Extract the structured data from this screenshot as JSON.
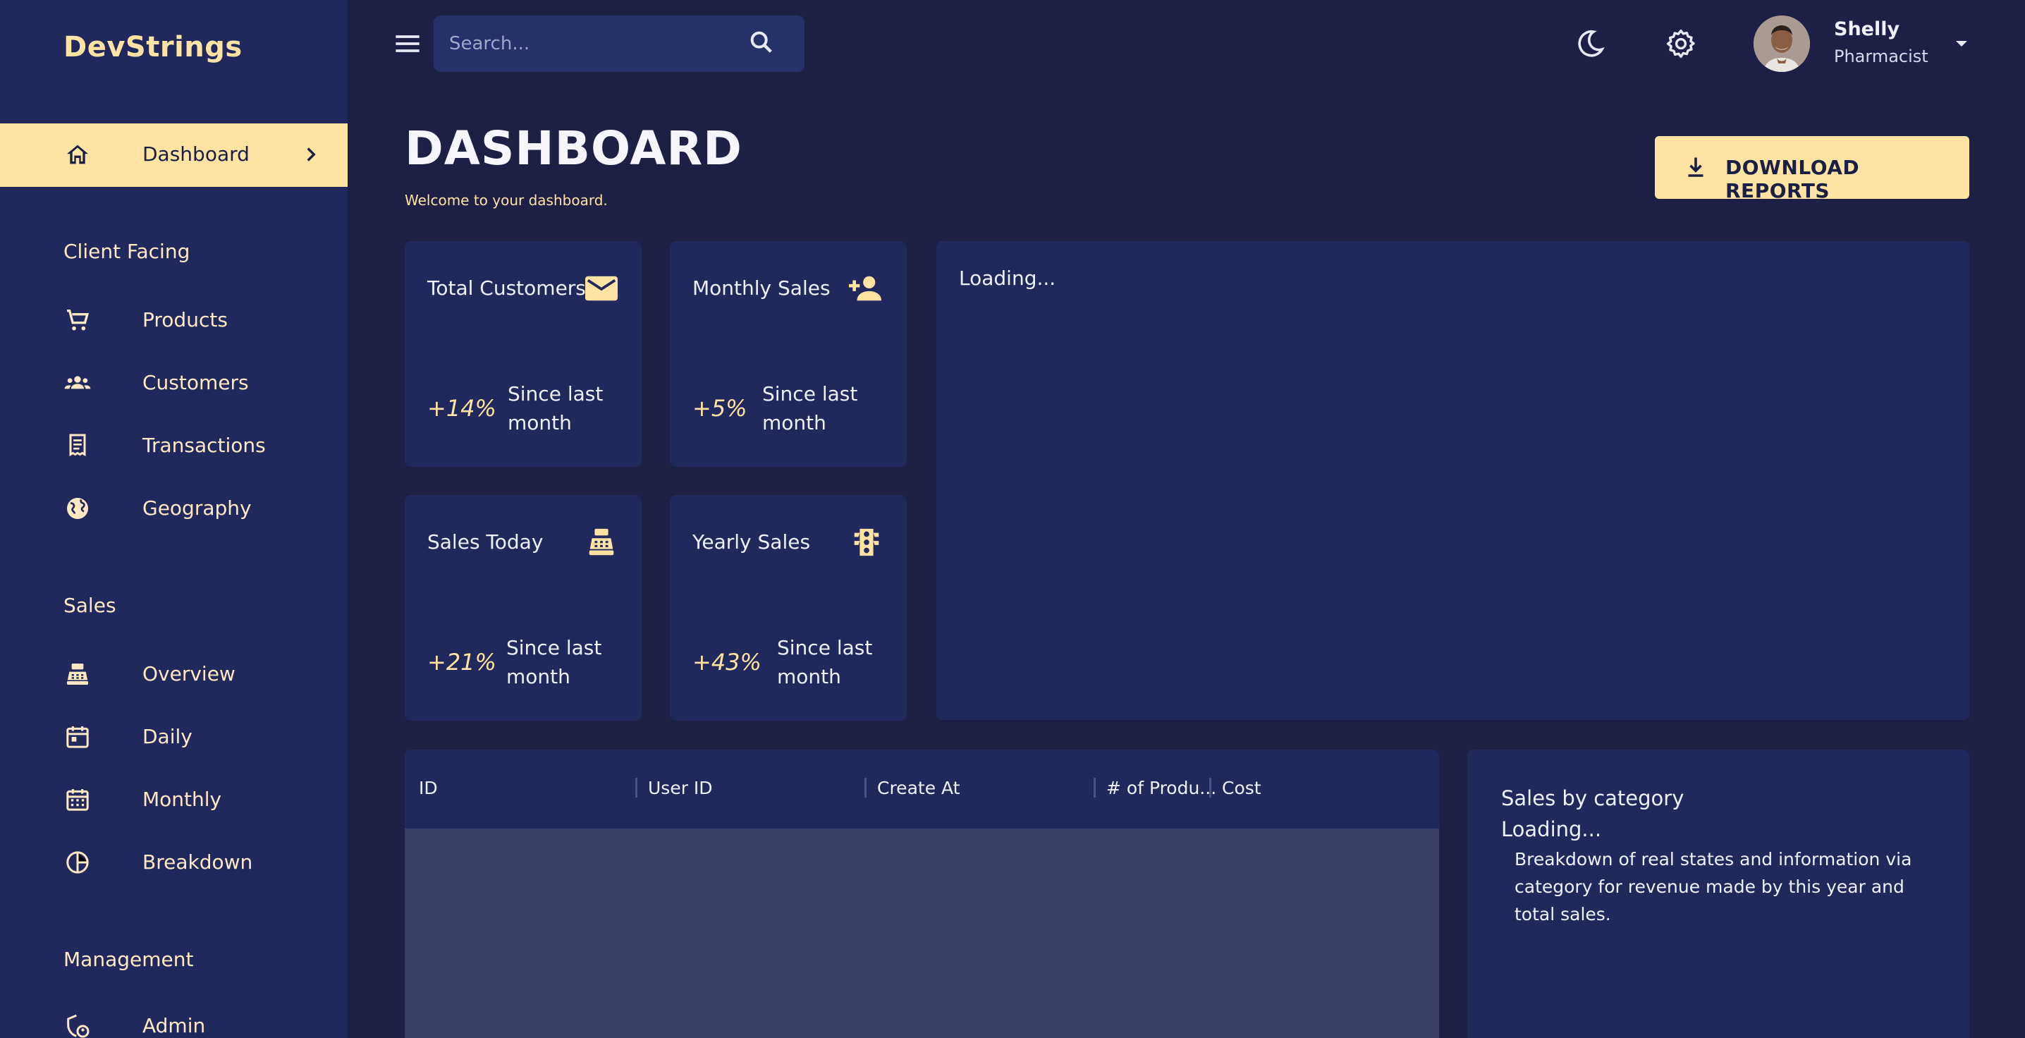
{
  "app": {
    "brand": "DevStrings"
  },
  "sidebar": {
    "active": {
      "label": "Dashboard",
      "icon": "home-icon"
    },
    "sections": [
      {
        "title": "Client Facing",
        "items": [
          {
            "label": "Products",
            "icon": "cart-icon"
          },
          {
            "label": "Customers",
            "icon": "groups-icon"
          },
          {
            "label": "Transactions",
            "icon": "receipt-icon"
          },
          {
            "label": "Geography",
            "icon": "globe-icon"
          }
        ]
      },
      {
        "title": "Sales",
        "items": [
          {
            "label": "Overview",
            "icon": "point-of-sale-icon"
          },
          {
            "label": "Daily",
            "icon": "calendar-today-icon"
          },
          {
            "label": "Monthly",
            "icon": "calendar-month-icon"
          },
          {
            "label": "Breakdown",
            "icon": "pie-chart-icon"
          }
        ]
      },
      {
        "title": "Management",
        "items": [
          {
            "label": "Admin",
            "icon": "admin-shield-icon"
          }
        ]
      }
    ]
  },
  "topbar": {
    "search_placeholder": "Search...",
    "user": {
      "name": "Shelly",
      "role": "Pharmacist"
    }
  },
  "header": {
    "title": "DASHBOARD",
    "subtitle": "Welcome to your dashboard.",
    "download_label": "DOWNLOAD REPORTS"
  },
  "stats": [
    {
      "title": "Total Customers",
      "pct": "+14%",
      "since": "Since last month",
      "icon": "email-icon"
    },
    {
      "title": "Monthly Sales",
      "pct": "+5%",
      "since": "Since last month",
      "icon": "person-add-icon"
    },
    {
      "title": "Sales Today",
      "pct": "+21%",
      "since": "Since last month",
      "icon": "point-of-sale-icon"
    },
    {
      "title": "Yearly Sales",
      "pct": "+43%",
      "since": "Since last month",
      "icon": "traffic-icon"
    }
  ],
  "chart_panel": {
    "loading": "Loading..."
  },
  "table": {
    "columns": [
      "ID",
      "User ID",
      "Create At",
      "# of Produ...",
      "Cost"
    ]
  },
  "category": {
    "title": "Sales by category",
    "loading": "Loading...",
    "description": "Breakdown of real states and information via category for revenue made by this year and total sales."
  },
  "colors": {
    "accent": "#ffe3a3",
    "sidebar_bg": "#21295c",
    "page_bg": "#1d1f45"
  }
}
